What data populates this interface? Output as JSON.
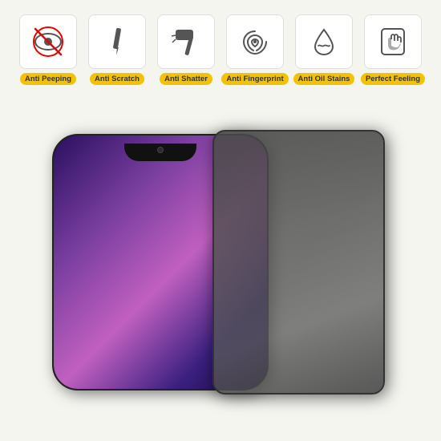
{
  "features": [
    {
      "id": "anti-peeping",
      "label": "Anti Peeping",
      "icon": "eye-slash"
    },
    {
      "id": "anti-scratch",
      "label": "Anti Scratch",
      "icon": "scratch"
    },
    {
      "id": "anti-shatter",
      "label": "Anti Shatter",
      "icon": "hammer"
    },
    {
      "id": "anti-fingerprint",
      "label": "Anti Fingerprint",
      "icon": "fingerprint"
    },
    {
      "id": "anti-oil-stains",
      "label": "Anti Oil Stains",
      "icon": "drop"
    },
    {
      "id": "perfect-feeling",
      "label": "Perfect Feeling",
      "icon": "touch"
    }
  ],
  "accent_color": "#f5c200",
  "background_color": "#f5f5f0"
}
